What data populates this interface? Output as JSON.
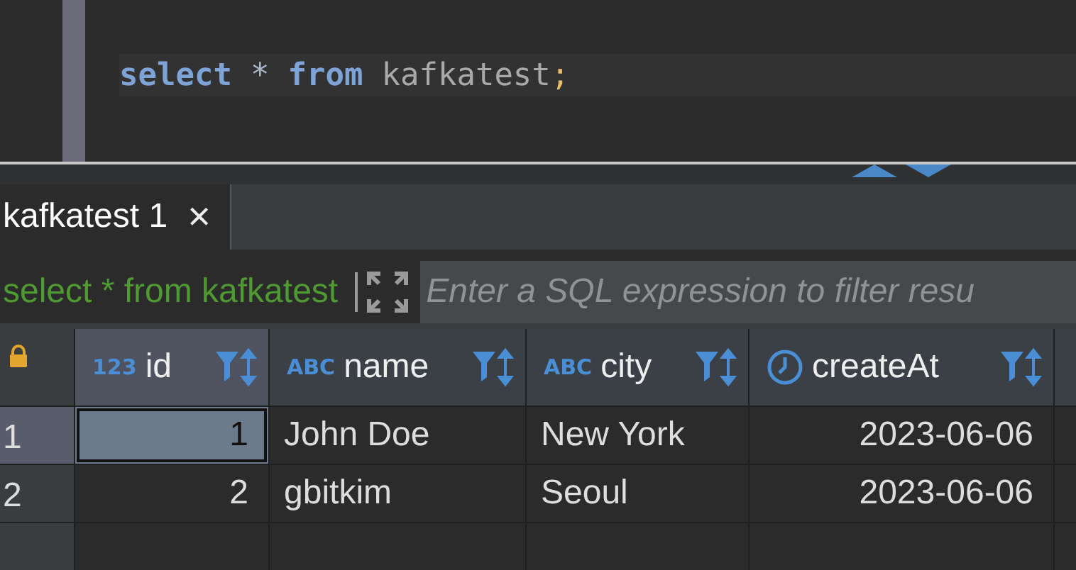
{
  "editor": {
    "code": [
      {
        "kind": "keyword",
        "text": "select"
      },
      {
        "kind": "plain",
        "text": "*"
      },
      {
        "kind": "keyword",
        "text": "from"
      },
      {
        "kind": "identifier",
        "text": "kafkatest"
      },
      {
        "kind": "punct",
        "text": ";"
      }
    ]
  },
  "result_tabs": [
    {
      "label": "kafkatest 1",
      "selected": true,
      "close": "×"
    }
  ],
  "filter_bar": {
    "query": "select * from kafkatest",
    "placeholder": "Enter a SQL expression to filter resu"
  },
  "grid": {
    "columns": [
      {
        "name": "id",
        "kind": "numeric",
        "type_label": "123",
        "selected": true
      },
      {
        "name": "name",
        "kind": "string",
        "type_label": "ABC",
        "selected": false
      },
      {
        "name": "city",
        "kind": "string",
        "type_label": "ABC",
        "selected": false
      },
      {
        "name": "createAt",
        "kind": "datetime",
        "selected": false
      }
    ],
    "rows": [
      {
        "number": "1",
        "selected": true,
        "cells": [
          {
            "value": "1",
            "selected": true
          },
          {
            "value": "John Doe",
            "selected": false
          },
          {
            "value": "New York",
            "selected": false
          },
          {
            "value": "2023-06-06",
            "selected": false
          }
        ]
      },
      {
        "number": "2",
        "selected": false,
        "cells": [
          {
            "value": "2",
            "selected": false
          },
          {
            "value": "gbitkim",
            "selected": false
          },
          {
            "value": "Seoul",
            "selected": false
          },
          {
            "value": "2023-06-06",
            "selected": false
          }
        ]
      }
    ]
  }
}
